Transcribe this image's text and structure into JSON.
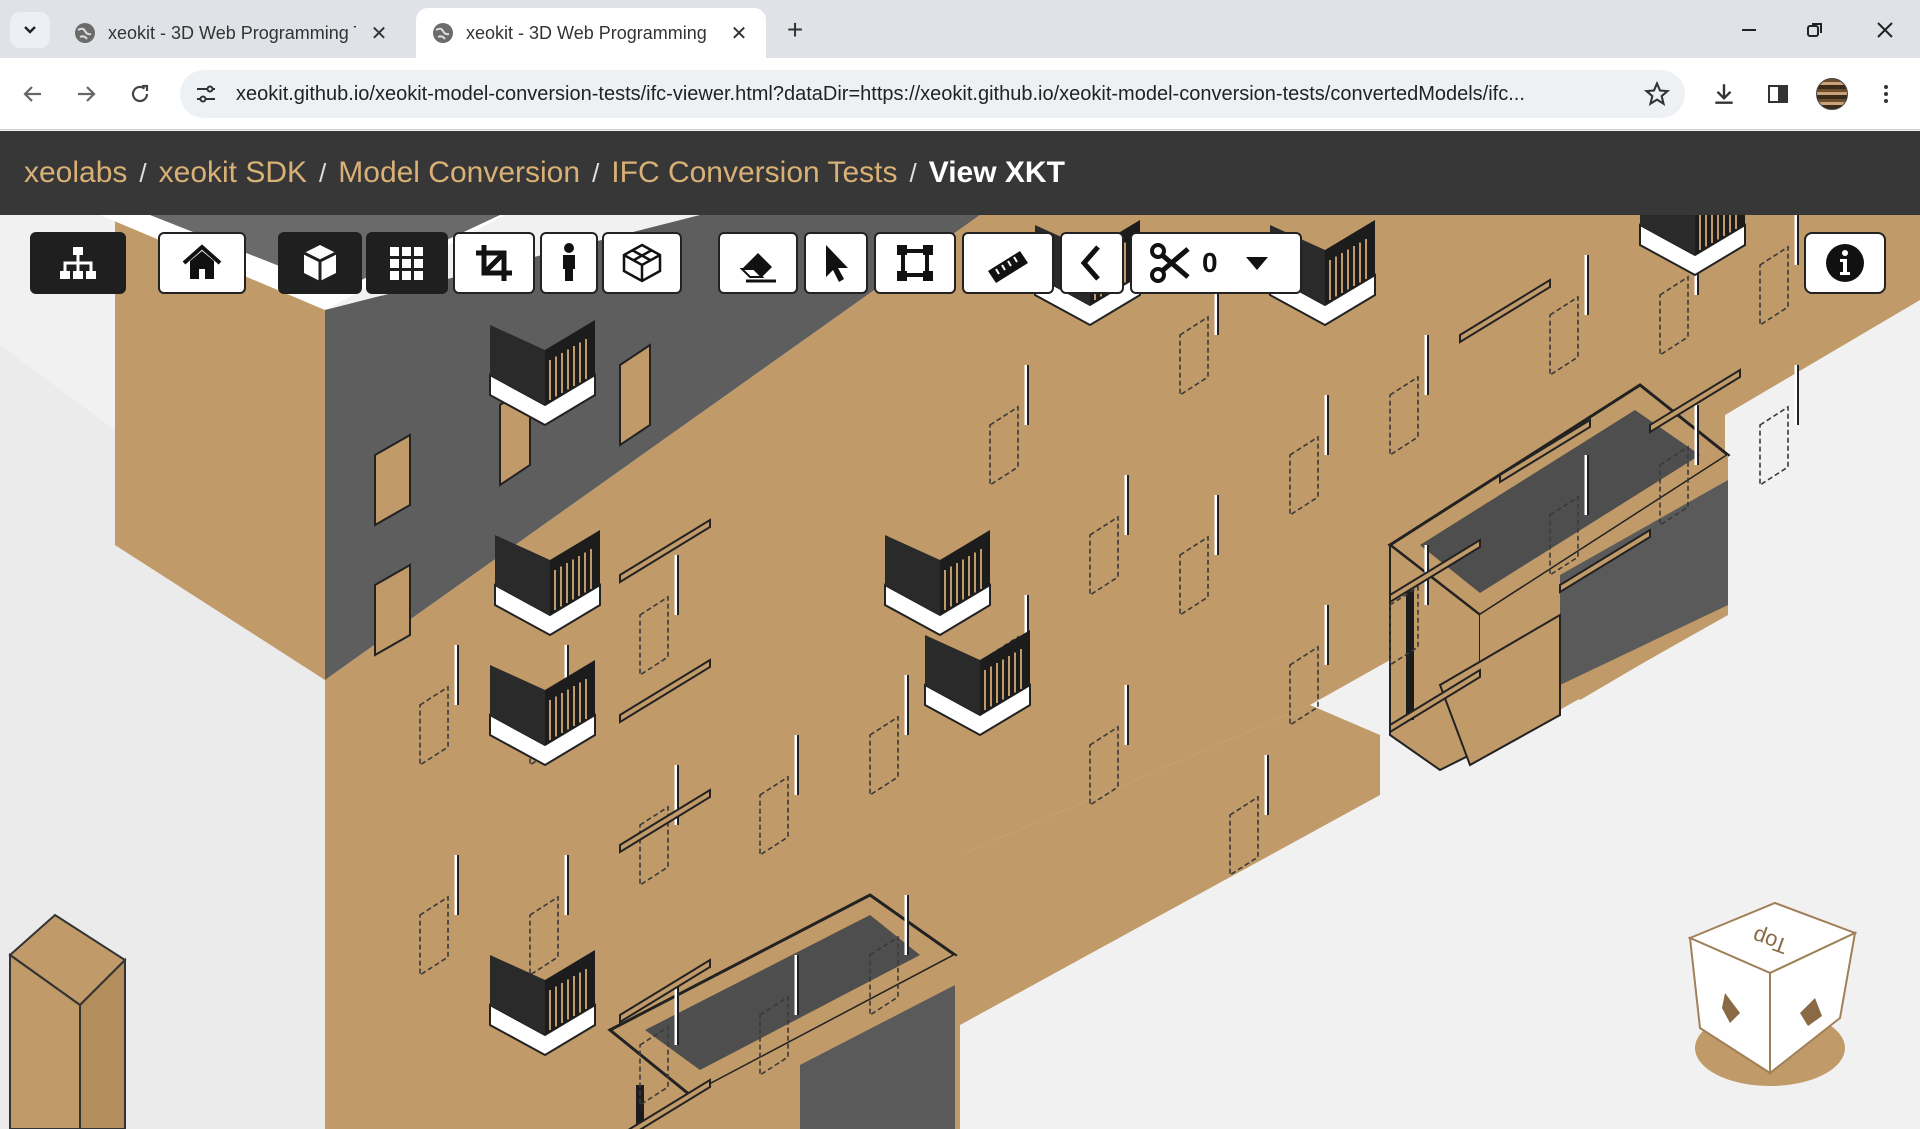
{
  "browser": {
    "tabs": [
      {
        "title": "xeokit - 3D Web Programming T",
        "active": false
      },
      {
        "title": "xeokit - 3D Web Programming",
        "active": true
      }
    ],
    "url": "xeokit.github.io/xeokit-model-conversion-tests/ifc-viewer.html?dataDir=https://xeokit.github.io/xeokit-model-conversion-tests/convertedModels/ifc..."
  },
  "breadcrumb": {
    "items": [
      "xeolabs",
      "xeokit SDK",
      "Model Conversion",
      "IFC Conversion Tests"
    ],
    "separator": "/",
    "current": "View XKT"
  },
  "viewer_toolbar": {
    "buttons": [
      {
        "name": "tree-view-button",
        "icon": "sitemap-icon",
        "active": true
      },
      {
        "name": "reset-view-button",
        "icon": "home-icon",
        "active": false
      },
      {
        "name": "perspective-button",
        "icon": "cube-icon",
        "active": true
      },
      {
        "name": "fit-view-button",
        "icon": "grid-icon",
        "active": true
      },
      {
        "name": "crop-button",
        "icon": "crop-icon",
        "active": false
      },
      {
        "name": "first-person-button",
        "icon": "person-icon",
        "active": false
      },
      {
        "name": "xray-button",
        "icon": "wireframe-cube-icon",
        "active": false
      },
      {
        "name": "hide-button",
        "icon": "eraser-icon",
        "active": false
      },
      {
        "name": "select-button",
        "icon": "pointer-icon",
        "active": false
      },
      {
        "name": "marquee-button",
        "icon": "marquee-icon",
        "active": false
      },
      {
        "name": "measure-button",
        "icon": "ruler-icon",
        "active": false
      },
      {
        "name": "measure-angle-button",
        "icon": "angle-icon",
        "active": false
      }
    ],
    "section_count": "0",
    "info_icon": "info-icon"
  },
  "navcube": {
    "face_label": "Top"
  },
  "colors": {
    "facade": "#c09a68",
    "facade_dark": "#a98553",
    "side_gray": "#5c5c5c",
    "rail": "#1c1c1c",
    "breadcrumb_bg": "#373737",
    "breadcrumb_link": "#d9b076"
  }
}
